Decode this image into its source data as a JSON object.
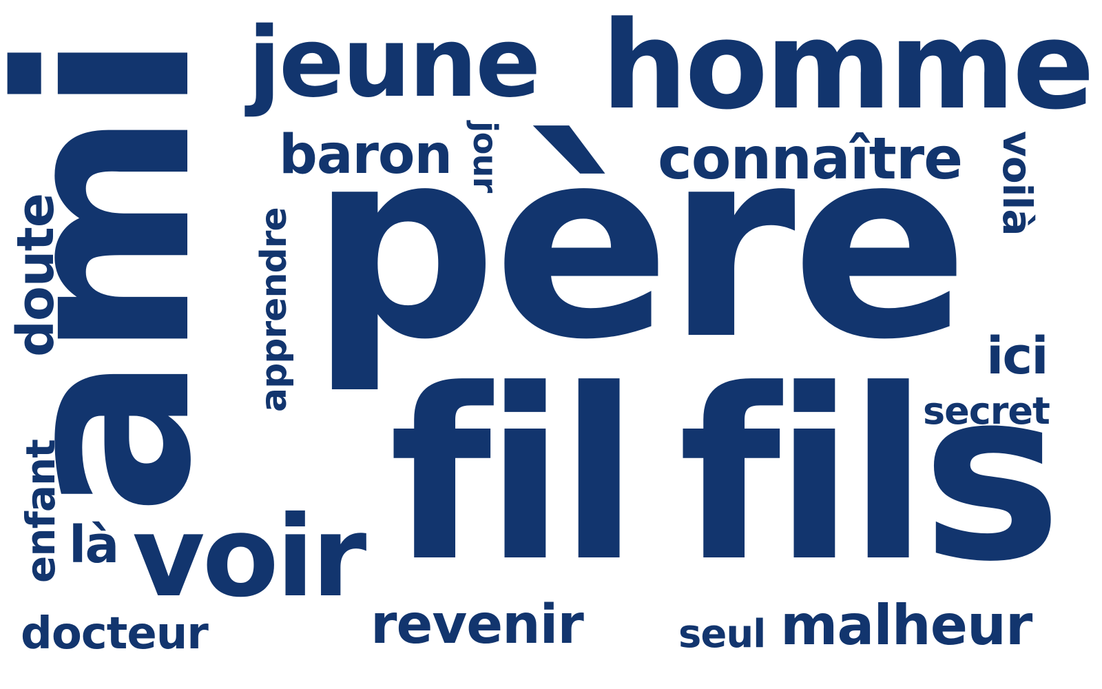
{
  "word_cloud": {
    "color": "#12356e",
    "background": "#ffffff",
    "words": [
      {
        "id": "pere",
        "text": "père"
      },
      {
        "id": "ami",
        "text": "ami"
      },
      {
        "id": "fil",
        "text": "fil"
      },
      {
        "id": "fils",
        "text": "fils"
      },
      {
        "id": "homme",
        "text": "homme"
      },
      {
        "id": "jeune",
        "text": "jeune"
      },
      {
        "id": "voir",
        "text": "voir"
      },
      {
        "id": "connaitre",
        "text": "connaître"
      },
      {
        "id": "malheur",
        "text": "malheur"
      },
      {
        "id": "baron",
        "text": "baron"
      },
      {
        "id": "revenir",
        "text": "revenir"
      },
      {
        "id": "docteur",
        "text": "docteur"
      },
      {
        "id": "doute",
        "text": "doute"
      },
      {
        "id": "enfant",
        "text": "enfant"
      },
      {
        "id": "apprendre",
        "text": "apprendre"
      },
      {
        "id": "voila",
        "text": "voilà"
      },
      {
        "id": "ici",
        "text": "ici"
      },
      {
        "id": "secret",
        "text": "secret"
      },
      {
        "id": "la",
        "text": "là"
      },
      {
        "id": "seul",
        "text": "seul"
      },
      {
        "id": "jour",
        "text": "jour"
      }
    ]
  }
}
